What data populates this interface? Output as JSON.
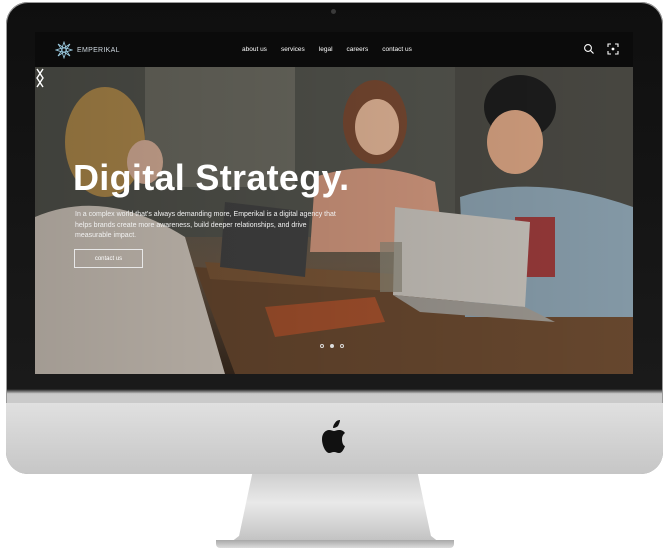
{
  "nav": {
    "brand": "EMPERIKAL",
    "links": [
      "about us",
      "services",
      "legal",
      "careers",
      "contact us"
    ],
    "icons": [
      "search-icon",
      "expand-icon"
    ]
  },
  "hero": {
    "title": "Digital Strategy.",
    "description": "In a complex world that's always demanding more, Emperikal is a digital agency that helps brands create more awareness, build deeper relationships, and drive measurable impact.",
    "cta_label": "contact us",
    "slides_total": 3,
    "slide_active": 2
  },
  "colors": {
    "nav_bg": "#0b0b0b",
    "text": "#ffffff",
    "frame": "#111111",
    "chin": "#d0d0d0"
  }
}
